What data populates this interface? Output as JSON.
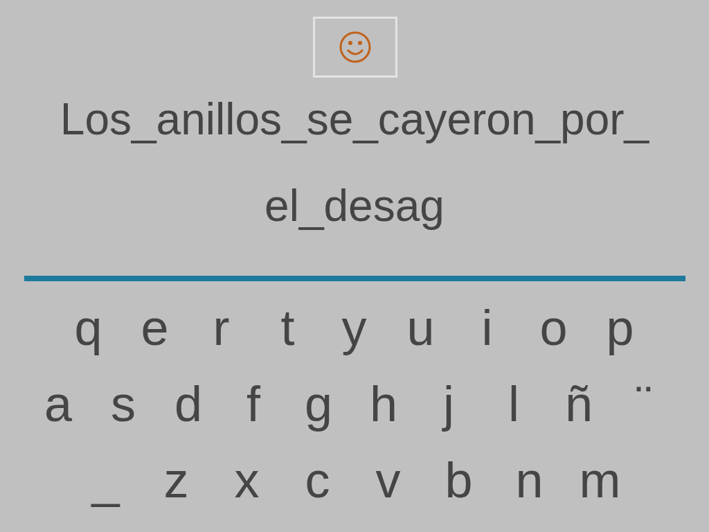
{
  "phrase_lines": [
    "Los_anillos_se_cayeron_por_",
    "el_desag"
  ],
  "keyboard_rows": [
    [
      "q",
      "e",
      "r",
      "t",
      "y",
      "u",
      "i",
      "o",
      "p"
    ],
    [
      "a",
      "s",
      "d",
      "f",
      "g",
      "h",
      "j",
      "l",
      "ñ",
      "¨"
    ],
    [
      "_",
      "z",
      "x",
      "c",
      "v",
      "b",
      "n",
      "m"
    ]
  ]
}
